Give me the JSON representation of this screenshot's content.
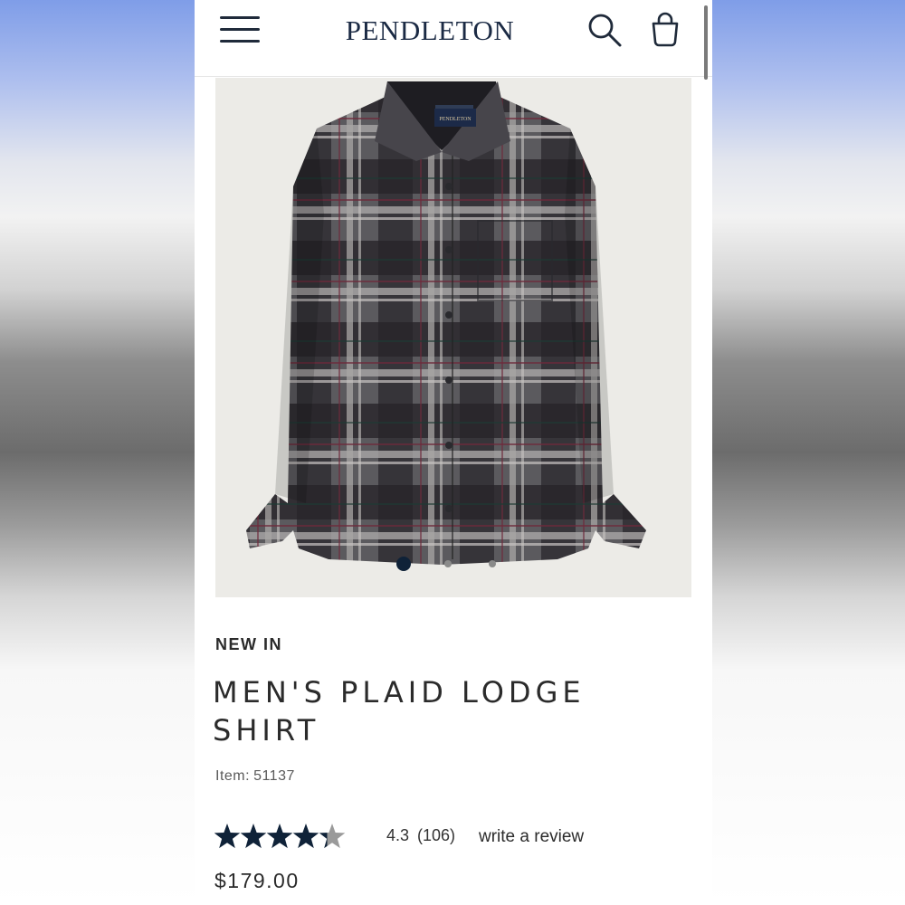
{
  "header": {
    "brand": "PENDLETON",
    "menu_icon": "hamburger-menu-icon",
    "search_icon": "search-icon",
    "bag_icon": "shopping-bag-icon"
  },
  "product": {
    "badge": "NEW IN",
    "title_line1": "MEN'S PLAID LODGE",
    "title_line2": "SHIRT",
    "item_label": "Item:",
    "item_number": "51137",
    "rating": "4.3",
    "rating_value": 4.3,
    "rating_max": 5,
    "review_count": "(106)",
    "write_review": "write a review",
    "price": "$179.00",
    "image_label_text": "PENDLETON"
  },
  "carousel": {
    "total": 3,
    "active_index": 1
  },
  "colors": {
    "brand_navy": "#1b2a44",
    "star_fill": "#0f2238",
    "star_empty": "#9a9a9a",
    "text": "#2b2b2b"
  }
}
